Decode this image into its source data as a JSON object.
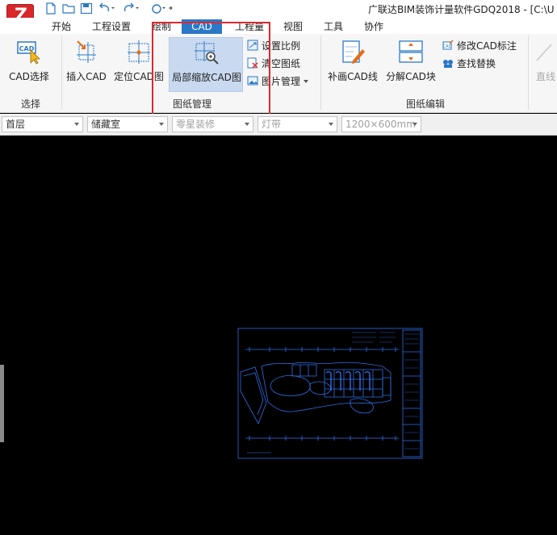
{
  "window": {
    "title": "广联达BIM装饰计量软件GDQ2018 - [C:\\U",
    "logo_letter": "Z"
  },
  "tabs": [
    {
      "label": "开始"
    },
    {
      "label": "工程设置"
    },
    {
      "label": "绘制"
    },
    {
      "label": "CAD",
      "active": true
    },
    {
      "label": "工程量"
    },
    {
      "label": "视图"
    },
    {
      "label": "工具"
    },
    {
      "label": "协作"
    }
  ],
  "ribbon": {
    "select_group": {
      "label": "选择",
      "cad_select": "CAD选择"
    },
    "drawing_mgmt_group": {
      "label": "图纸管理",
      "insert_cad": "插入CAD",
      "locate_cad": "定位CAD图",
      "local_zoom": "局部缩放CAD图",
      "set_scale": "设置比例",
      "clear_drawing": "清空图纸",
      "image_mgmt": "图片管理"
    },
    "drawing_edit_group": {
      "label": "图纸编辑",
      "add_cad_line": "补画CAD线",
      "explode_cad_block": "分解CAD块",
      "modify_cad_label": "修改CAD标注",
      "find_replace": "查找替换",
      "line_truncated": "直线"
    }
  },
  "dropdowns": {
    "floor": "首层",
    "room": "储藏室",
    "component_type": "零星装修",
    "component": "灯带",
    "size": "1200×600mm"
  },
  "colors": {
    "accent": "#2b78c6",
    "highlight_border": "#e0282d",
    "cad_lines": "#2f6fe8",
    "canvas_bg": "#000000"
  }
}
